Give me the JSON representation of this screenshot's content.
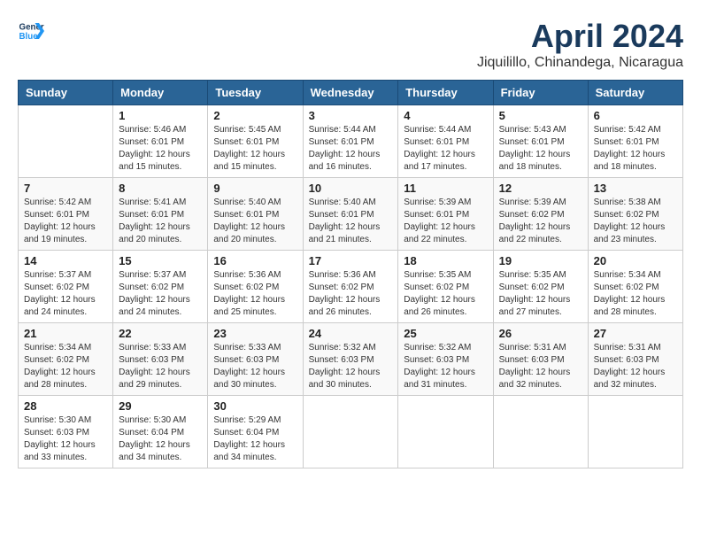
{
  "header": {
    "logo_line1": "General",
    "logo_line2": "Blue",
    "month_title": "April 2024",
    "location": "Jiquilillo, Chinandega, Nicaragua"
  },
  "weekdays": [
    "Sunday",
    "Monday",
    "Tuesday",
    "Wednesday",
    "Thursday",
    "Friday",
    "Saturday"
  ],
  "weeks": [
    [
      {
        "day": "",
        "info": ""
      },
      {
        "day": "1",
        "info": "Sunrise: 5:46 AM\nSunset: 6:01 PM\nDaylight: 12 hours\nand 15 minutes."
      },
      {
        "day": "2",
        "info": "Sunrise: 5:45 AM\nSunset: 6:01 PM\nDaylight: 12 hours\nand 15 minutes."
      },
      {
        "day": "3",
        "info": "Sunrise: 5:44 AM\nSunset: 6:01 PM\nDaylight: 12 hours\nand 16 minutes."
      },
      {
        "day": "4",
        "info": "Sunrise: 5:44 AM\nSunset: 6:01 PM\nDaylight: 12 hours\nand 17 minutes."
      },
      {
        "day": "5",
        "info": "Sunrise: 5:43 AM\nSunset: 6:01 PM\nDaylight: 12 hours\nand 18 minutes."
      },
      {
        "day": "6",
        "info": "Sunrise: 5:42 AM\nSunset: 6:01 PM\nDaylight: 12 hours\nand 18 minutes."
      }
    ],
    [
      {
        "day": "7",
        "info": "Sunrise: 5:42 AM\nSunset: 6:01 PM\nDaylight: 12 hours\nand 19 minutes."
      },
      {
        "day": "8",
        "info": "Sunrise: 5:41 AM\nSunset: 6:01 PM\nDaylight: 12 hours\nand 20 minutes."
      },
      {
        "day": "9",
        "info": "Sunrise: 5:40 AM\nSunset: 6:01 PM\nDaylight: 12 hours\nand 20 minutes."
      },
      {
        "day": "10",
        "info": "Sunrise: 5:40 AM\nSunset: 6:01 PM\nDaylight: 12 hours\nand 21 minutes."
      },
      {
        "day": "11",
        "info": "Sunrise: 5:39 AM\nSunset: 6:01 PM\nDaylight: 12 hours\nand 22 minutes."
      },
      {
        "day": "12",
        "info": "Sunrise: 5:39 AM\nSunset: 6:02 PM\nDaylight: 12 hours\nand 22 minutes."
      },
      {
        "day": "13",
        "info": "Sunrise: 5:38 AM\nSunset: 6:02 PM\nDaylight: 12 hours\nand 23 minutes."
      }
    ],
    [
      {
        "day": "14",
        "info": "Sunrise: 5:37 AM\nSunset: 6:02 PM\nDaylight: 12 hours\nand 24 minutes."
      },
      {
        "day": "15",
        "info": "Sunrise: 5:37 AM\nSunset: 6:02 PM\nDaylight: 12 hours\nand 24 minutes."
      },
      {
        "day": "16",
        "info": "Sunrise: 5:36 AM\nSunset: 6:02 PM\nDaylight: 12 hours\nand 25 minutes."
      },
      {
        "day": "17",
        "info": "Sunrise: 5:36 AM\nSunset: 6:02 PM\nDaylight: 12 hours\nand 26 minutes."
      },
      {
        "day": "18",
        "info": "Sunrise: 5:35 AM\nSunset: 6:02 PM\nDaylight: 12 hours\nand 26 minutes."
      },
      {
        "day": "19",
        "info": "Sunrise: 5:35 AM\nSunset: 6:02 PM\nDaylight: 12 hours\nand 27 minutes."
      },
      {
        "day": "20",
        "info": "Sunrise: 5:34 AM\nSunset: 6:02 PM\nDaylight: 12 hours\nand 28 minutes."
      }
    ],
    [
      {
        "day": "21",
        "info": "Sunrise: 5:34 AM\nSunset: 6:02 PM\nDaylight: 12 hours\nand 28 minutes."
      },
      {
        "day": "22",
        "info": "Sunrise: 5:33 AM\nSunset: 6:03 PM\nDaylight: 12 hours\nand 29 minutes."
      },
      {
        "day": "23",
        "info": "Sunrise: 5:33 AM\nSunset: 6:03 PM\nDaylight: 12 hours\nand 30 minutes."
      },
      {
        "day": "24",
        "info": "Sunrise: 5:32 AM\nSunset: 6:03 PM\nDaylight: 12 hours\nand 30 minutes."
      },
      {
        "day": "25",
        "info": "Sunrise: 5:32 AM\nSunset: 6:03 PM\nDaylight: 12 hours\nand 31 minutes."
      },
      {
        "day": "26",
        "info": "Sunrise: 5:31 AM\nSunset: 6:03 PM\nDaylight: 12 hours\nand 32 minutes."
      },
      {
        "day": "27",
        "info": "Sunrise: 5:31 AM\nSunset: 6:03 PM\nDaylight: 12 hours\nand 32 minutes."
      }
    ],
    [
      {
        "day": "28",
        "info": "Sunrise: 5:30 AM\nSunset: 6:03 PM\nDaylight: 12 hours\nand 33 minutes."
      },
      {
        "day": "29",
        "info": "Sunrise: 5:30 AM\nSunset: 6:04 PM\nDaylight: 12 hours\nand 34 minutes."
      },
      {
        "day": "30",
        "info": "Sunrise: 5:29 AM\nSunset: 6:04 PM\nDaylight: 12 hours\nand 34 minutes."
      },
      {
        "day": "",
        "info": ""
      },
      {
        "day": "",
        "info": ""
      },
      {
        "day": "",
        "info": ""
      },
      {
        "day": "",
        "info": ""
      }
    ]
  ]
}
